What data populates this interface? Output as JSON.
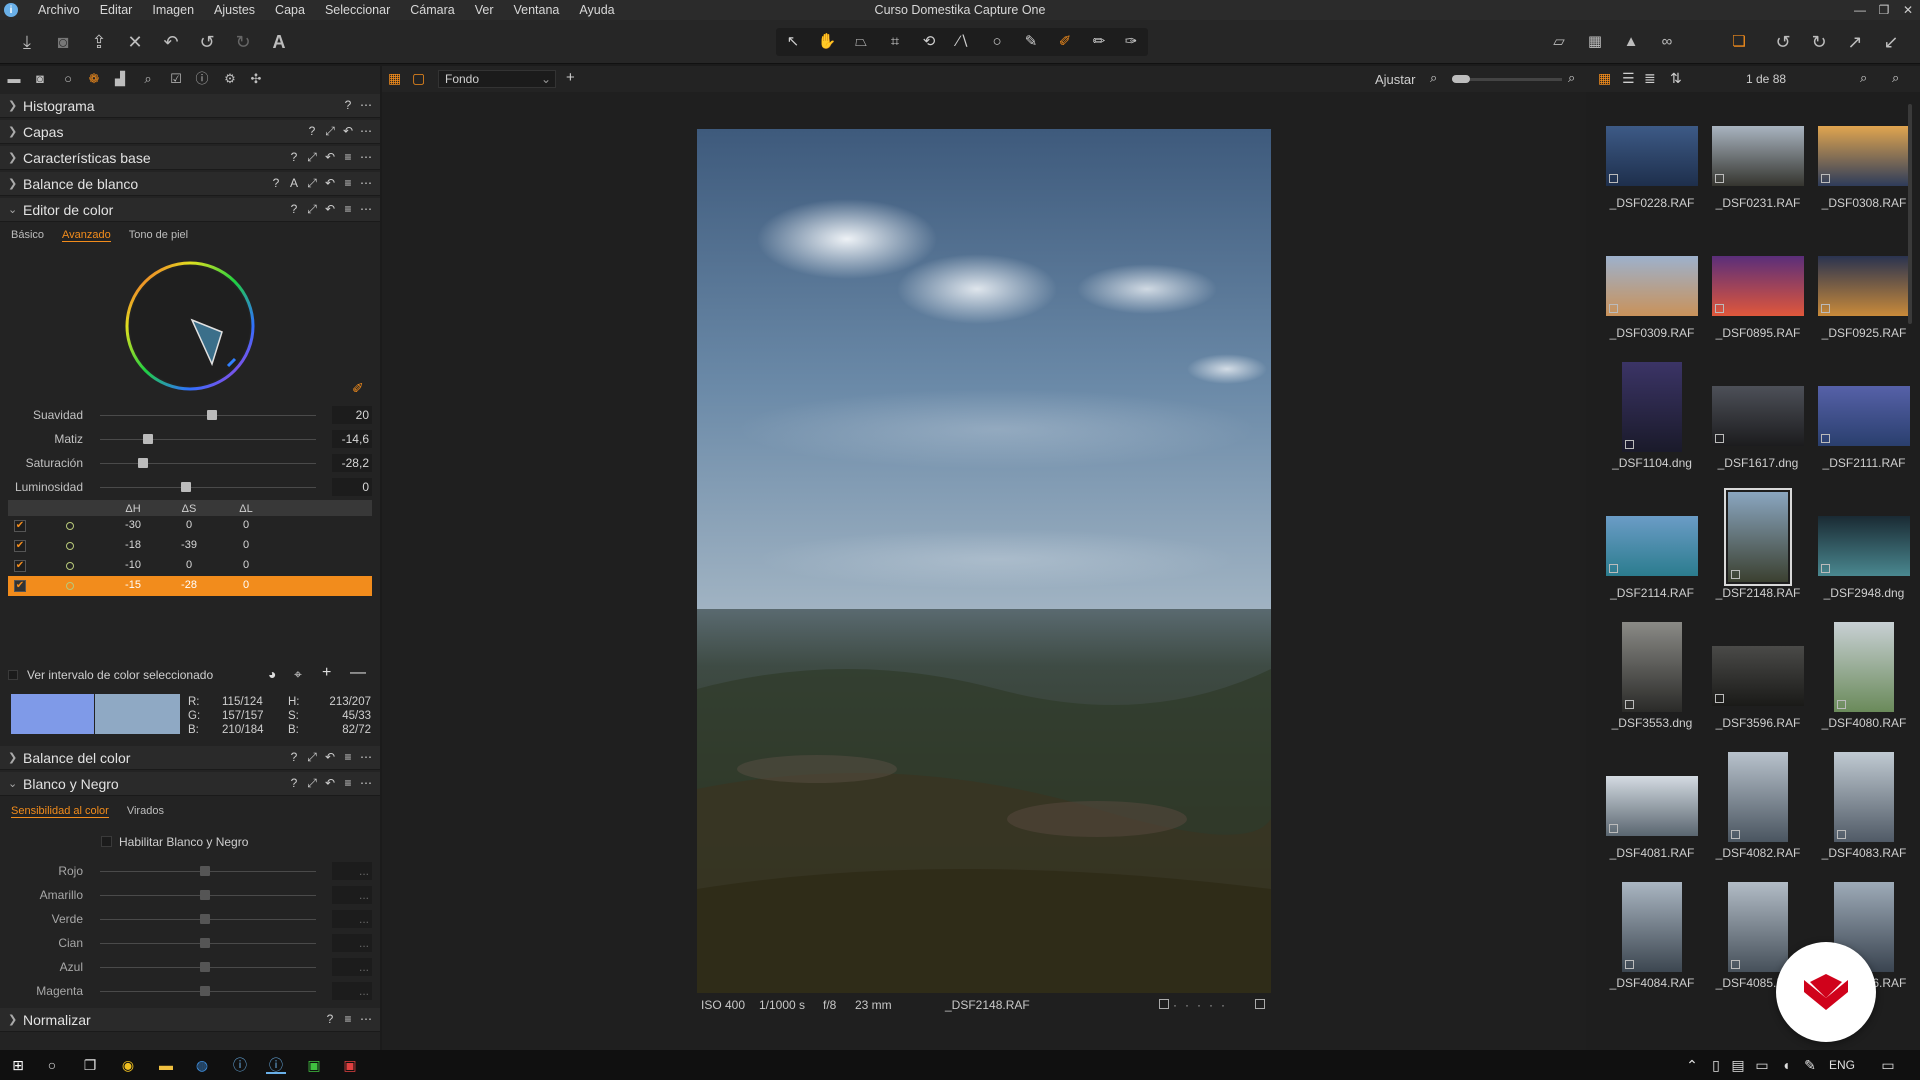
{
  "window": {
    "title": "Curso Domestika Capture One",
    "controls": [
      "—",
      "❐",
      "✕"
    ]
  },
  "menu": [
    "Archivo",
    "Editar",
    "Imagen",
    "Ajustes",
    "Capa",
    "Seleccionar",
    "Cámara",
    "Ver",
    "Ventana",
    "Ayuda"
  ],
  "viewer_toolbar": {
    "background_select": "Fondo",
    "fit_label": "Ajustar",
    "counter": "1 de 88"
  },
  "sections": {
    "histograma": "Histograma",
    "capas": "Capas",
    "caracteristicas": "Características base",
    "balance_blanco": "Balance de blanco",
    "editor_color": "Editor de color",
    "balance_color": "Balance del color",
    "blanco_negro": "Blanco y Negro",
    "normalizar": "Normalizar"
  },
  "editor_color": {
    "tabs": [
      "Básico",
      "Avanzado",
      "Tono de piel"
    ],
    "active_tab": "Avanzado",
    "sliders": [
      {
        "label": "Suavidad",
        "value": "20",
        "pos": 0.52
      },
      {
        "label": "Matiz",
        "value": "-14,6",
        "pos": 0.22
      },
      {
        "label": "Saturación",
        "value": "-28,2",
        "pos": 0.2
      },
      {
        "label": "Luminosidad",
        "value": "0",
        "pos": 0.4
      }
    ],
    "table_headers": [
      "ΔH",
      "ΔS",
      "ΔL"
    ],
    "table_rows": [
      {
        "dh": "-30",
        "ds": "0",
        "dl": "0"
      },
      {
        "dh": "-18",
        "ds": "-39",
        "dl": "0"
      },
      {
        "dh": "-10",
        "ds": "0",
        "dl": "0"
      },
      {
        "dh": "-15",
        "ds": "-28",
        "dl": "0"
      }
    ],
    "view_range_label": "Ver intervalo de color seleccionado",
    "swatch_before": "#7f9ae8",
    "swatch_after": "#8fa9c4",
    "readout": {
      "r": "115/124",
      "g": "157/157",
      "b": "210/184",
      "h": "213/207",
      "s": "45/33",
      "bl": "82/72",
      "r_label": "R:",
      "g_label": "G:",
      "b_label": "B:",
      "h_label": "H:",
      "s_label": "S:",
      "bl_label": "B:"
    }
  },
  "blanco_negro": {
    "tabs": [
      "Sensibilidad al color",
      "Virados"
    ],
    "active_tab": "Sensibilidad al color",
    "enable_label": "Habilitar Blanco y Negro",
    "sliders": [
      {
        "label": "Rojo",
        "value": "..."
      },
      {
        "label": "Amarillo",
        "value": "..."
      },
      {
        "label": "Verde",
        "value": "..."
      },
      {
        "label": "Cian",
        "value": "..."
      },
      {
        "label": "Azul",
        "value": "..."
      },
      {
        "label": "Magenta",
        "value": "..."
      }
    ]
  },
  "photo_info": {
    "iso": "ISO 400",
    "shutter": "1/1000 s",
    "aperture": "f/8",
    "focal": "23 mm",
    "filename": "_DSF2148.RAF"
  },
  "thumbnails": [
    {
      "name": "_DSF0228.RAF",
      "c1": "#3d5a86",
      "c2": "#1e2f4c"
    },
    {
      "name": "_DSF0231.RAF",
      "c1": "#a9b4c0",
      "c2": "#35352f"
    },
    {
      "name": "_DSF0308.RAF",
      "c1": "#e0a54f",
      "c2": "#2e3c5a"
    },
    {
      "name": "_DSF0309.RAF",
      "c1": "#9db1cc",
      "c2": "#c9925a"
    },
    {
      "name": "_DSF0895.RAF",
      "c1": "#5a2e7a",
      "c2": "#e0573b"
    },
    {
      "name": "_DSF0925.RAF",
      "c1": "#2a3350",
      "c2": "#c98a3a"
    },
    {
      "name": "_DSF1104.dng",
      "c1": "#3b3466",
      "c2": "#1a1a2a"
    },
    {
      "name": "_DSF1617.dng",
      "c1": "#4d5058",
      "c2": "#1c1c1e"
    },
    {
      "name": "_DSF2111.RAF",
      "c1": "#5661a8",
      "c2": "#2a3f6e"
    },
    {
      "name": "_DSF2114.RAF",
      "c1": "#6b9cc6",
      "c2": "#2b7c8e"
    },
    {
      "name": "_DSF2148.RAF",
      "c1": "#8aa6c0",
      "c2": "#3b4030"
    },
    {
      "name": "_DSF2948.dng",
      "c1": "#1a2a33",
      "c2": "#4a8890"
    },
    {
      "name": "_DSF3553.dng",
      "c1": "#8a8a86",
      "c2": "#2a2a28"
    },
    {
      "name": "_DSF3596.RAF",
      "c1": "#4a4a48",
      "c2": "#1a1a18"
    },
    {
      "name": "_DSF4080.RAF",
      "c1": "#c8d0d4",
      "c2": "#6a8a5a"
    },
    {
      "name": "_DSF4081.RAF",
      "c1": "#d4dbe2",
      "c2": "#5a6670"
    },
    {
      "name": "_DSF4082.RAF",
      "c1": "#b8c2cc",
      "c2": "#4a5560"
    },
    {
      "name": "_DSF4083.RAF",
      "c1": "#c0cad2",
      "c2": "#505a66"
    },
    {
      "name": "_DSF4084.RAF",
      "c1": "#aab6c2",
      "c2": "#3c4650"
    },
    {
      "name": "_DSF4085.RAF",
      "c1": "#b2bcc6",
      "c2": "#46505a"
    },
    {
      "name": "_DSF4086.RAF",
      "c1": "#9eabb8",
      "c2": "#3a4450"
    }
  ],
  "selected_thumbnail": "_DSF2148.RAF",
  "taskbar": {
    "language": "ENG"
  },
  "colors": {
    "accent": "#f28c1c",
    "logo": "#d0021b"
  }
}
